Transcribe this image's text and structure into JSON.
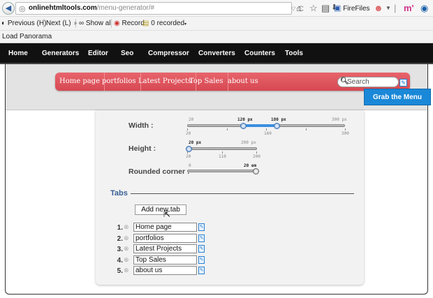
{
  "browser": {
    "url_domain": "onlinehtmltools.com",
    "url_path": "/menu-generator/#",
    "firefiles_label": "FireFiles",
    "toolbar": {
      "previous": "Previous (H)",
      "next": "Next (L)",
      "show_all": "Show all",
      "record": "Record",
      "recorded": "0 recorded"
    },
    "bookmark": "Load Panorama"
  },
  "site_nav": [
    "Home",
    "Generators",
    "Editor",
    "Seo",
    "Compressor",
    "Converters",
    "Counters",
    "Tools"
  ],
  "demo_menu": {
    "tabs": [
      "Home page",
      "portfolios",
      "Latest Projects",
      "Top Sales",
      "about us"
    ],
    "search_placeholder": "Search",
    "accent": "#d64852"
  },
  "grab_button": "Grab the Menu Code",
  "options": {
    "width": {
      "label": "Width :",
      "min_label": "20",
      "max_label": "300 px",
      "low_value": "120 px",
      "high_value": "180 px",
      "ticks": [
        "20",
        "160",
        "300"
      ],
      "min": 20,
      "max": 300,
      "low": 120,
      "high": 180
    },
    "height": {
      "label": "Height :",
      "min_label": "20 px",
      "max_label": "200 px",
      "value_label": "20 px",
      "ticks": [
        "20",
        "110",
        "200"
      ],
      "min": 20,
      "max": 200,
      "value": 20
    },
    "corner": {
      "label": "Rounded corner :",
      "min_label": "0",
      "value_label": "20 em",
      "min": 0,
      "max": 20,
      "value": 20
    }
  },
  "tabs_section": {
    "legend": "Tabs",
    "add_button": "Add new tab",
    "rows": [
      {
        "num": "1.",
        "value": "Home page"
      },
      {
        "num": "2.",
        "value": "portfolios"
      },
      {
        "num": "3.",
        "value": "Latest Projects"
      },
      {
        "num": "4.",
        "value": "Top Sales"
      },
      {
        "num": "5.",
        "value": "about us"
      }
    ]
  }
}
